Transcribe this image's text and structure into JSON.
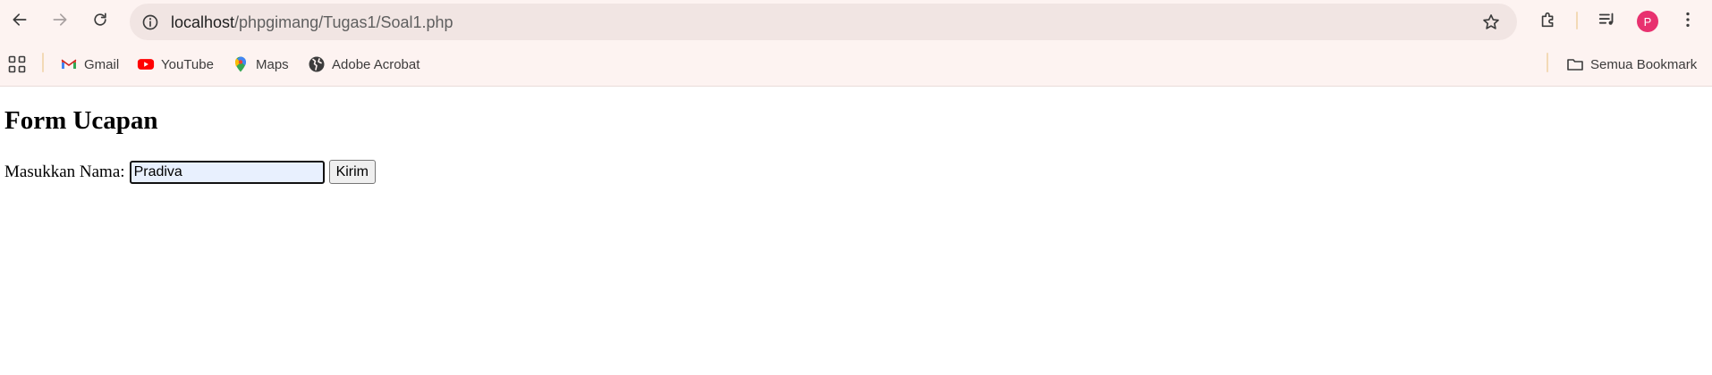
{
  "browser": {
    "address": {
      "host": "localhost",
      "path": "/phpgimang/Tugas1/Soal1.php"
    },
    "profile_initial": "P",
    "colors": {
      "toolbar_bg": "#fdf3f1",
      "omnibox_bg": "#f1e5e3",
      "avatar": "#e8316f",
      "separator": "#f3d9b6"
    }
  },
  "bookmarks": {
    "items": [
      {
        "label": "Gmail",
        "icon": "gmail-icon"
      },
      {
        "label": "YouTube",
        "icon": "youtube-icon"
      },
      {
        "label": "Maps",
        "icon": "maps-icon"
      },
      {
        "label": "Adobe Acrobat",
        "icon": "globe-icon"
      }
    ],
    "all_bookmarks": {
      "label": "Semua Bookmark",
      "icon": "folder-icon"
    }
  },
  "page": {
    "heading": "Form Ucapan",
    "form": {
      "name_label": "Masukkan Nama:",
      "name_value": "Pradiva",
      "submit_label": "Kirim"
    }
  }
}
